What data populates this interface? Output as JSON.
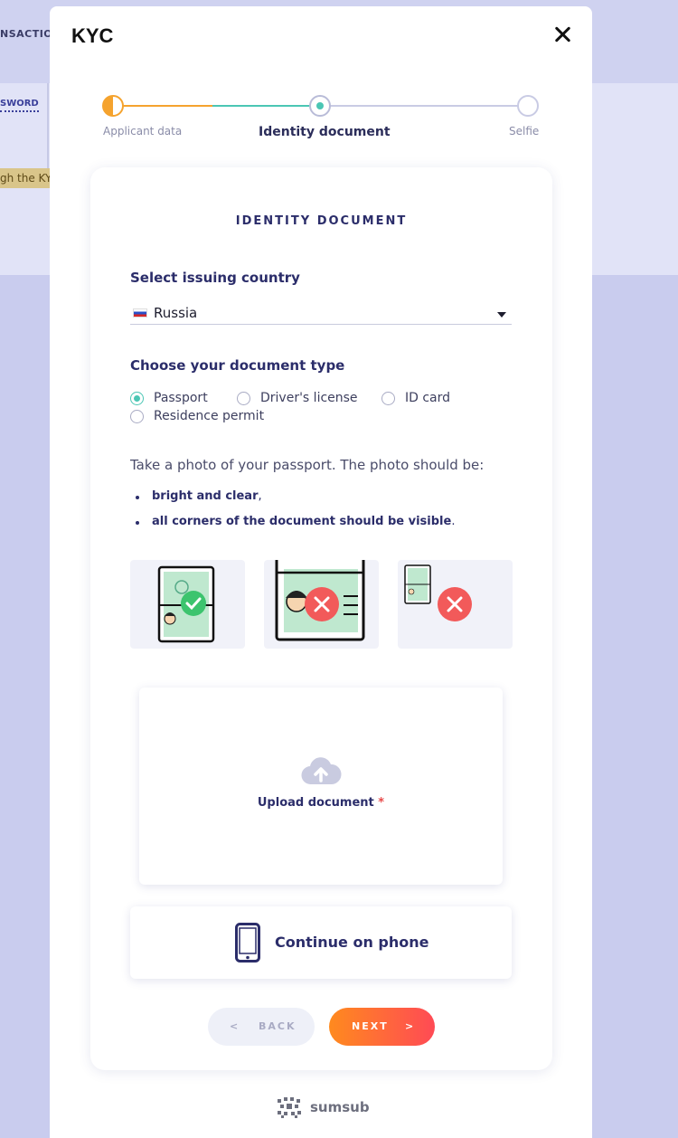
{
  "background": {
    "tab_label": "NSACTION",
    "link_label": "SWORD",
    "banner_text": "gh the KY"
  },
  "modal": {
    "title": "KYC",
    "close_icon": "close-icon"
  },
  "stepper": {
    "steps": [
      {
        "label": "Applicant data",
        "state": "in-progress"
      },
      {
        "label": "Identity document",
        "state": "active"
      },
      {
        "label": "Selfie",
        "state": "pending"
      }
    ]
  },
  "card": {
    "heading": "IDENTITY DOCUMENT",
    "country": {
      "label": "Select issuing country",
      "value": "Russia",
      "flag_icon": "russia-flag-icon"
    },
    "doc_type": {
      "label": "Choose your document type",
      "options": [
        {
          "label": "Passport",
          "checked": true
        },
        {
          "label": "Driver's license",
          "checked": false
        },
        {
          "label": "ID card",
          "checked": false
        },
        {
          "label": "Residence permit",
          "checked": false
        }
      ]
    },
    "instruction": "Take a photo of your passport. The photo should be:",
    "requirements": [
      {
        "bold": "bright and clear",
        "tail": ","
      },
      {
        "bold": "all corners of the document should be visible",
        "tail": "."
      }
    ],
    "examples": [
      "correct-example",
      "too-close-example",
      "too-far-example"
    ],
    "upload": {
      "label": "Upload document",
      "required_mark": "*",
      "icon": "cloud-upload-icon"
    },
    "phone": {
      "label": "Continue on phone",
      "icon": "smartphone-icon"
    },
    "buttons": {
      "back_arrow": "<",
      "back_label": "BACK",
      "next_label": "NEXT",
      "next_arrow": ">"
    }
  },
  "footer": {
    "brand": "sumsub"
  },
  "colors": {
    "accent_teal": "#4bc6b4",
    "accent_orange": "#f5a32e",
    "primary_text": "#2b2d6a",
    "error_red": "#f25a5a",
    "success_green": "#3cc46e"
  }
}
